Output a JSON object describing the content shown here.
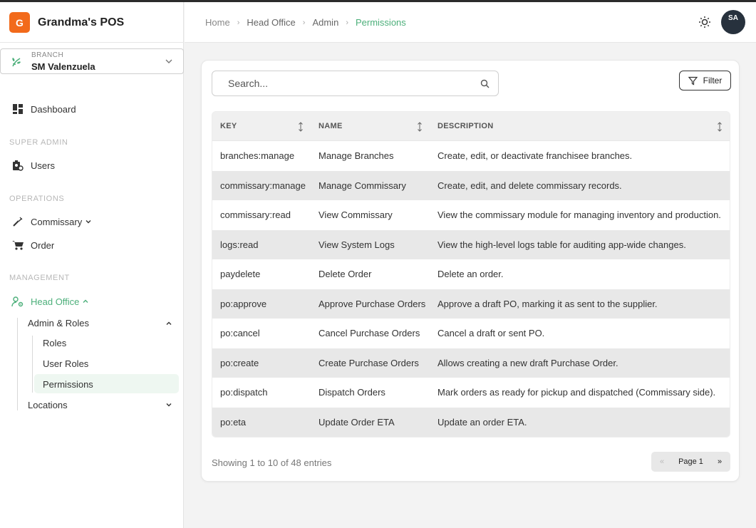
{
  "app": {
    "logo_letter": "G",
    "name": "Grandma's POS"
  },
  "branch": {
    "label": "BRANCH",
    "value": "SM Valenzuela"
  },
  "sidebar": {
    "dashboard": "Dashboard",
    "sections": {
      "super_admin": "SUPER ADMIN",
      "operations": "OPERATIONS",
      "management": "MANAGEMENT"
    },
    "users": "Users",
    "commissary": "Commissary",
    "order": "Order",
    "head_office": "Head Office",
    "admin_roles": "Admin & Roles",
    "roles": "Roles",
    "user_roles": "User Roles",
    "permissions": "Permissions",
    "locations": "Locations"
  },
  "breadcrumb": [
    "Home",
    "Head Office",
    "Admin",
    "Permissions"
  ],
  "user": {
    "initials": "SA"
  },
  "search": {
    "placeholder": "Search..."
  },
  "filter": {
    "label": "Filter"
  },
  "table": {
    "headers": {
      "key": "KEY",
      "name": "NAME",
      "description": "DESCRIPTION"
    },
    "rows": [
      {
        "key": "branches:manage",
        "name": "Manage Branches",
        "description": "Create, edit, or deactivate franchisee branches."
      },
      {
        "key": "commissary:manage",
        "name": "Manage Commissary",
        "description": "Create, edit, and delete commissary records."
      },
      {
        "key": "commissary:read",
        "name": "View Commissary",
        "description": "View the commissary module for managing inventory and production."
      },
      {
        "key": "logs:read",
        "name": "View System Logs",
        "description": "View the high-level logs table for auditing app-wide changes."
      },
      {
        "key": "paydelete",
        "name": "Delete Order",
        "description": "Delete an order."
      },
      {
        "key": "po:approve",
        "name": "Approve Purchase Orders",
        "description": "Approve a draft PO, marking it as sent to the supplier."
      },
      {
        "key": "po:cancel",
        "name": "Cancel Purchase Orders",
        "description": "Cancel a draft or sent PO."
      },
      {
        "key": "po:create",
        "name": "Create Purchase Orders",
        "description": "Allows creating a new draft Purchase Order."
      },
      {
        "key": "po:dispatch",
        "name": "Dispatch Orders",
        "description": "Mark orders as ready for pickup and dispatched (Commissary side)."
      },
      {
        "key": "po:eta",
        "name": "Update Order ETA",
        "description": "Update an order ETA."
      }
    ]
  },
  "footer": {
    "showing": "Showing 1 to 10 of 48 entries",
    "prev": "«",
    "page": "Page 1",
    "next": "»"
  },
  "colors": {
    "accent": "#4caf7a",
    "brand": "#f26a1b",
    "avatar": "#27313d"
  }
}
